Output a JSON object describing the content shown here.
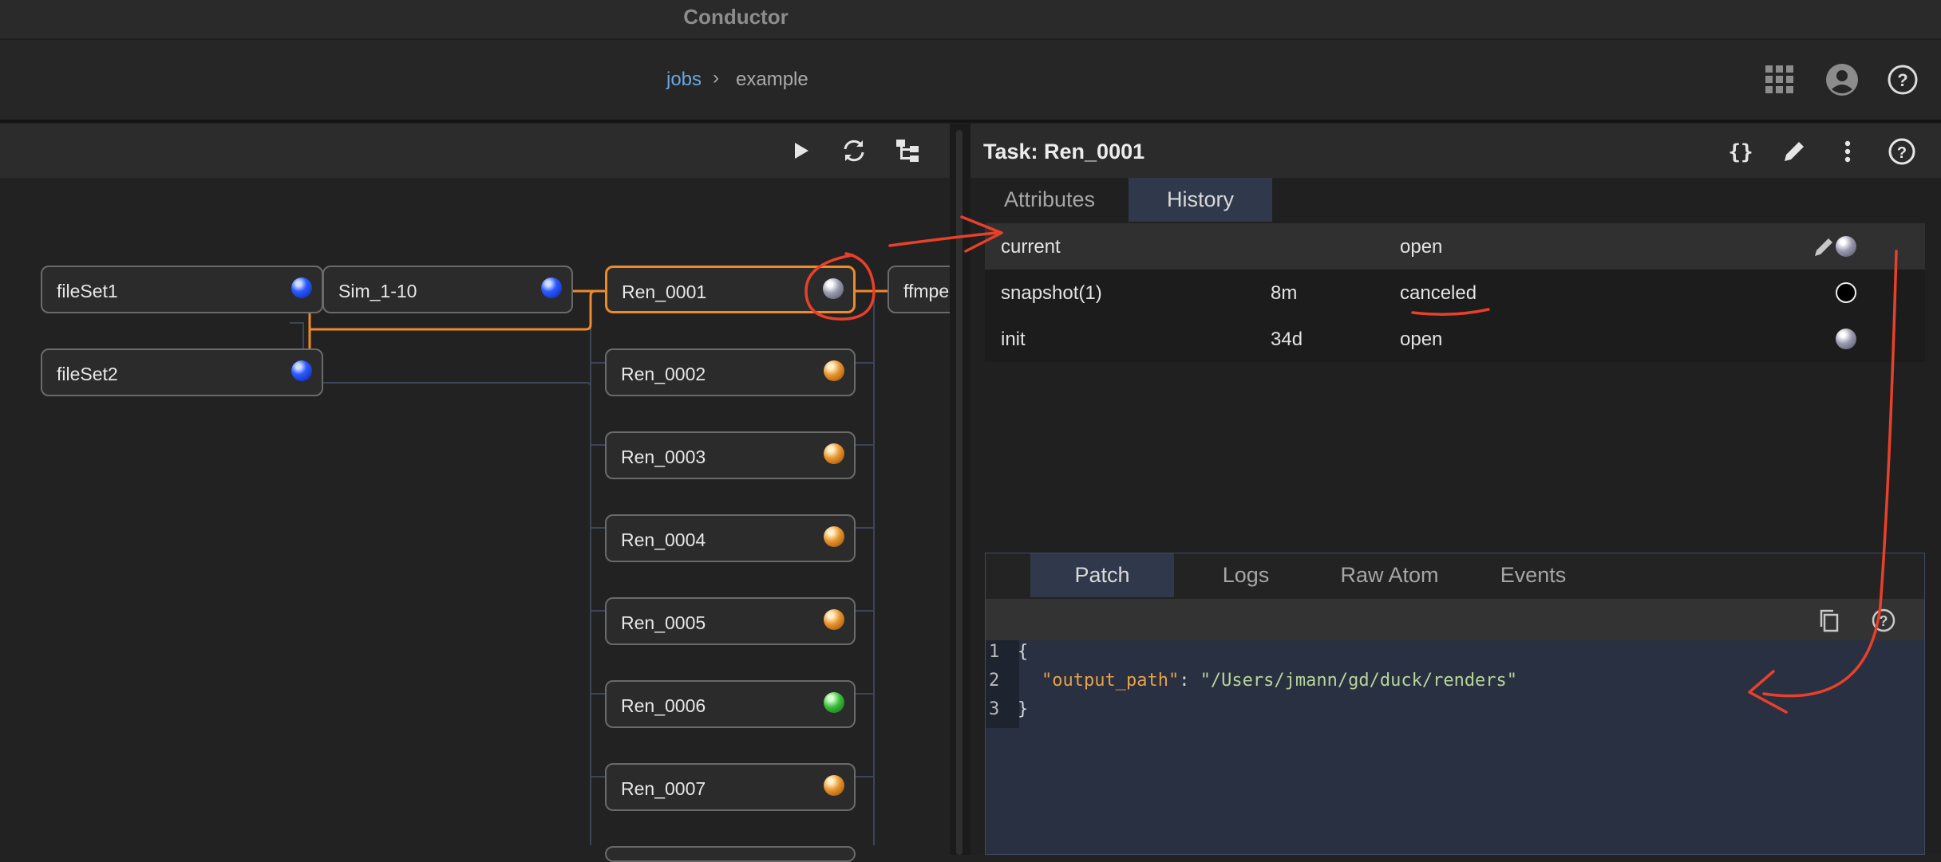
{
  "app": {
    "title": "Conductor"
  },
  "breadcrumb": {
    "jobs": "jobs",
    "separator": "›",
    "example": "example"
  },
  "header_icons": [
    "apps-grid-icon",
    "account-icon",
    "help-icon"
  ],
  "graph_toolbar": [
    "play-icon",
    "refresh-icon",
    "layout-tree-icon"
  ],
  "graph": {
    "nodes": [
      {
        "id": "fileSet1",
        "label": "fileSet1",
        "status": "blue"
      },
      {
        "id": "fileSet2",
        "label": "fileSet2",
        "status": "blue"
      },
      {
        "id": "Sim_1-10",
        "label": "Sim_1-10",
        "status": "blue"
      },
      {
        "id": "Ren_0001",
        "label": "Ren_0001",
        "status": "grey",
        "selected": true
      },
      {
        "id": "Ren_0002",
        "label": "Ren_0002",
        "status": "orange"
      },
      {
        "id": "Ren_0003",
        "label": "Ren_0003",
        "status": "orange"
      },
      {
        "id": "Ren_0004",
        "label": "Ren_0004",
        "status": "orange"
      },
      {
        "id": "Ren_0005",
        "label": "Ren_0005",
        "status": "orange"
      },
      {
        "id": "Ren_0006",
        "label": "Ren_0006",
        "status": "green"
      },
      {
        "id": "Ren_0007",
        "label": "Ren_0007",
        "status": "orange"
      },
      {
        "id": "ffmpeg",
        "label": "ffmpe",
        "status": "none"
      }
    ]
  },
  "task": {
    "title": "Task: Ren_0001",
    "icons": [
      "json-braces-icon",
      "edit-pencil-icon",
      "more-vert-icon",
      "help-icon"
    ],
    "tabs": [
      {
        "label": "Attributes"
      },
      {
        "label": "History",
        "active": true
      }
    ],
    "history": [
      {
        "name": "current",
        "age": "",
        "state": "open",
        "indicator": "grey",
        "editable": true
      },
      {
        "name": "snapshot(1)",
        "age": "8m",
        "state": "canceled",
        "indicator": "black"
      },
      {
        "name": "init",
        "age": "34d",
        "state": "open",
        "indicator": "grey"
      }
    ]
  },
  "detail": {
    "tabs": [
      {
        "label": "Patch",
        "active": true
      },
      {
        "label": "Logs"
      },
      {
        "label": "Raw Atom"
      },
      {
        "label": "Events"
      }
    ],
    "toolbar_icons": [
      "copy-icon",
      "help-icon"
    ],
    "code": {
      "line_numbers": [
        "1",
        "2",
        "3"
      ],
      "open_brace": "{",
      "key": "\"output_path\"",
      "colon": ": ",
      "value": "\"/Users/jmann/gd/duck/renders\"",
      "close_brace": "}"
    }
  },
  "colors": {
    "accent": "#ef8a2a",
    "link": "#6aa7df",
    "annotation": "#e8402a"
  }
}
